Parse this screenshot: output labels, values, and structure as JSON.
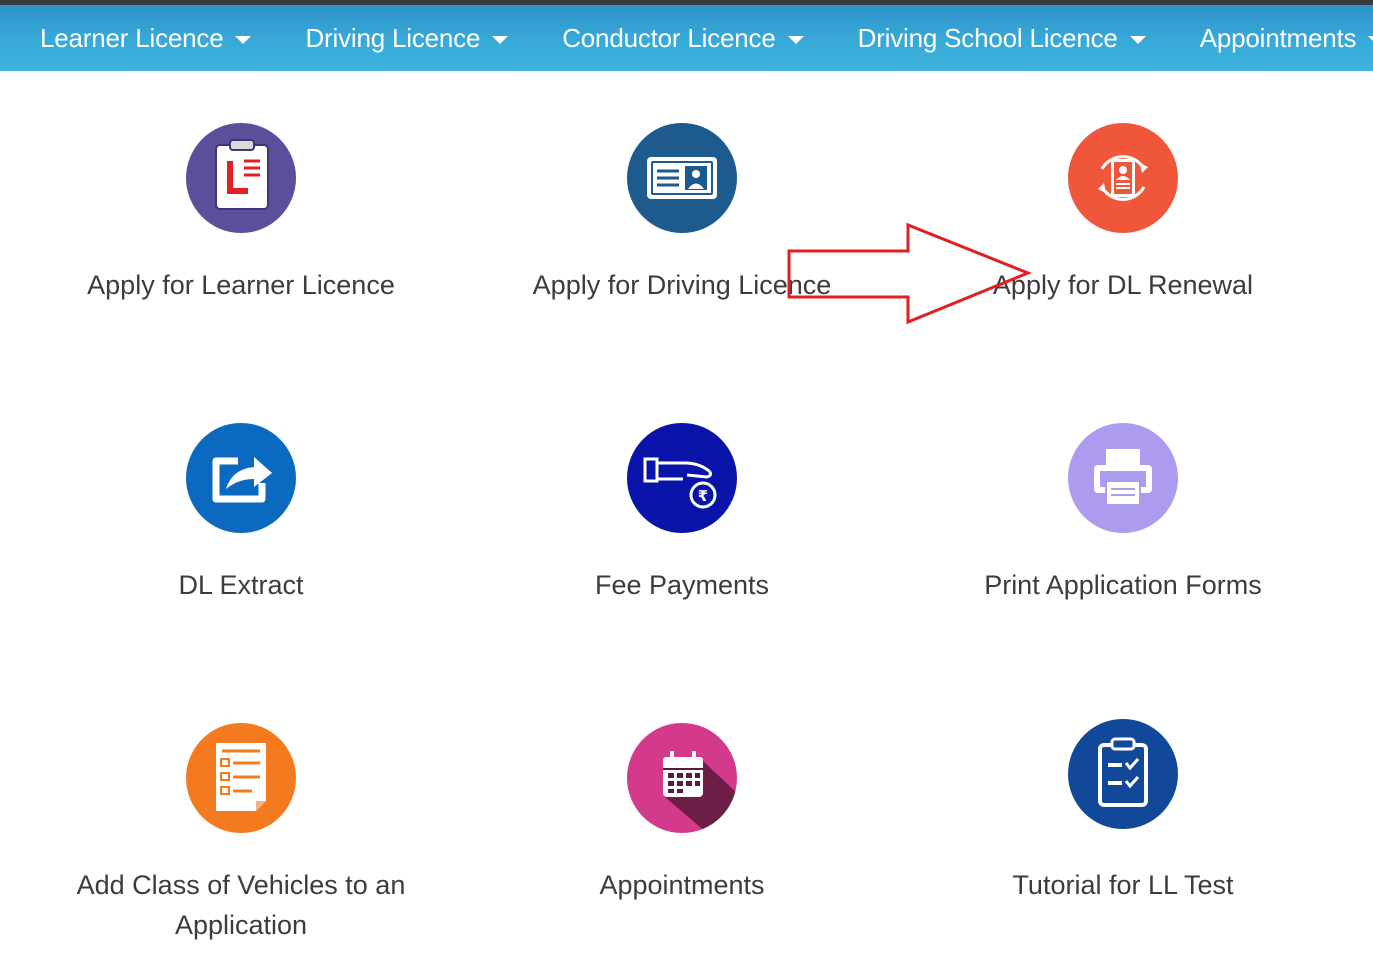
{
  "nav": {
    "items": [
      {
        "label": "Learner Licence"
      },
      {
        "label": "Driving Licence"
      },
      {
        "label": "Conductor Licence"
      },
      {
        "label": "Driving School Licence"
      },
      {
        "label": "Appointments"
      }
    ]
  },
  "tiles": [
    {
      "label": "Apply for Learner Licence",
      "icon": "clipboard-l-icon",
      "color": "#5b4e9b"
    },
    {
      "label": "Apply for Driving Licence",
      "icon": "id-card-icon",
      "color": "#1d5a8e"
    },
    {
      "label": "Apply for DL Renewal",
      "icon": "renewal-person-icon",
      "color": "#f0563a"
    },
    {
      "label": "DL Extract",
      "icon": "share-export-icon",
      "color": "#0b6abf"
    },
    {
      "label": "Fee Payments",
      "icon": "hand-rupee-icon",
      "color": "#0a14a8"
    },
    {
      "label": "Print Application Forms",
      "icon": "printer-icon",
      "color": "#ad9bf0"
    },
    {
      "label": "Add Class of Vehicles to an Application",
      "icon": "form-list-icon",
      "color": "#f47a1f"
    },
    {
      "label": "Appointments",
      "icon": "calendar-icon",
      "color": "#d43a8c"
    },
    {
      "label": "Tutorial for LL Test",
      "icon": "checklist-clipboard-icon",
      "color": "#12489a"
    }
  ],
  "annotation": {
    "arrow_color": "#e02020"
  }
}
